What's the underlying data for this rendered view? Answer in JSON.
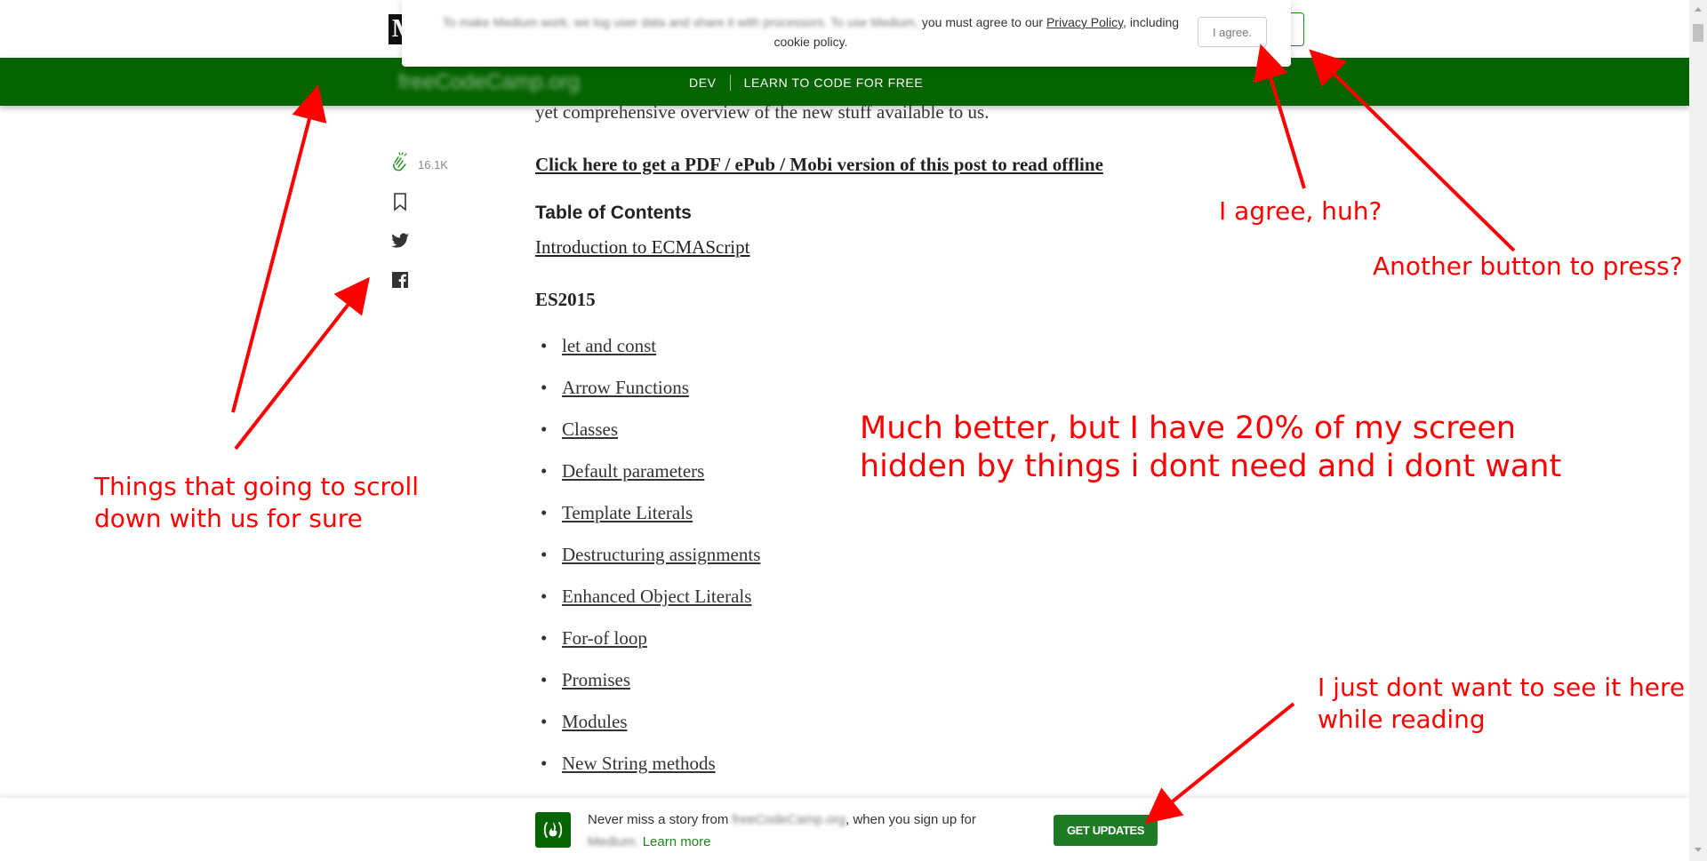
{
  "header": {
    "logo_letter": "M",
    "publication_name": "freeCodeCamp.org",
    "nav": [
      "DEV",
      "LEARN TO CODE FOR FREE"
    ]
  },
  "cookie_banner": {
    "text_blurred": "To make Medium work, we log user data and share it with processors. To use Medium,",
    "text_visible": " you must agree to our ",
    "privacy_link": "Privacy Policy",
    "text_after": ", including cookie policy.",
    "agree_button": "I agree."
  },
  "side_rail": {
    "clap_count": "16.1K",
    "icons": [
      "clap-icon",
      "bookmark-icon",
      "twitter-icon",
      "facebook-icon"
    ]
  },
  "article": {
    "intro_line": "yet comprehensive overview of the new stuff available to us.",
    "pdf_link": "Click here to get a PDF / ePub / Mobi version of this post to read offline",
    "toc_title": "Table of Contents",
    "toc_intro": "Introduction to ECMAScript",
    "section_heading": "ES2015",
    "toc_items": [
      "let and const",
      "Arrow Functions",
      "Classes",
      "Default parameters",
      "Template Literals",
      "Destructuring assignments",
      "Enhanced Object Literals",
      "For-of loop",
      "Promises",
      "Modules",
      "New String methods"
    ]
  },
  "bottom_bar": {
    "text_1": "Never miss a story from ",
    "publication_blurred": "freeCodeCamp.org",
    "text_2": ", when you sign up for",
    "medium_blurred": "Medium.",
    "learn_more": "Learn more",
    "button": "GET UPDATES"
  },
  "annotations": {
    "agree": "I agree, huh?",
    "another_button": "Another button to press?",
    "scroll": "Things that going to scroll down with us for sure",
    "better": "Much better, but I have 20% of my screen hidden by things i dont need and i dont want",
    "bottom": "I just dont want to see it here while reading"
  },
  "colors": {
    "publication_green": "#056400",
    "button_green": "#1e7a25",
    "annotation_red": "#ff0000"
  }
}
